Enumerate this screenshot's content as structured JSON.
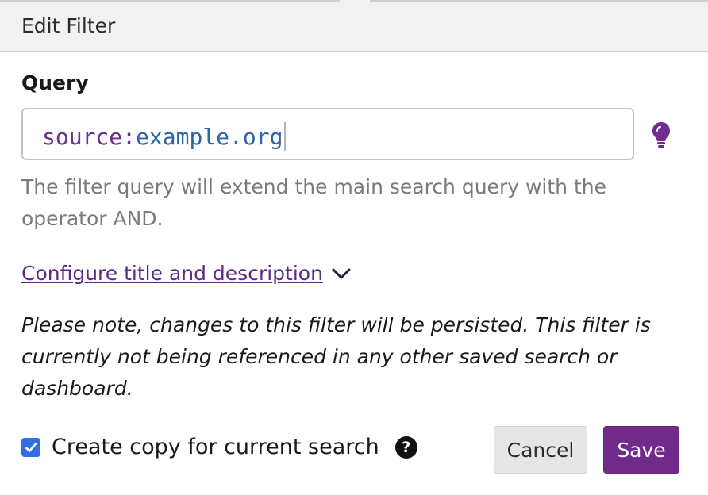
{
  "dialog": {
    "title": "Edit Filter"
  },
  "query": {
    "label": "Query",
    "value_key": "source",
    "value_colon": ":",
    "value_term": "example.org",
    "help_text": "The filter query will extend the main search query with the operator AND."
  },
  "configure": {
    "label": "Configure title and description",
    "icon": "chevron-down-icon"
  },
  "note": "Please note, changes to this filter will be persisted. This filter is currently not being referenced in any other saved search or dashboard.",
  "copy_option": {
    "label": "Create copy for current search",
    "checked": true,
    "help_icon": "question-circle-icon"
  },
  "buttons": {
    "cancel": "Cancel",
    "save": "Save"
  },
  "colors": {
    "accent": "#6f2a8a",
    "checkbox": "#2f6fe0",
    "link": "#5c2a86"
  }
}
